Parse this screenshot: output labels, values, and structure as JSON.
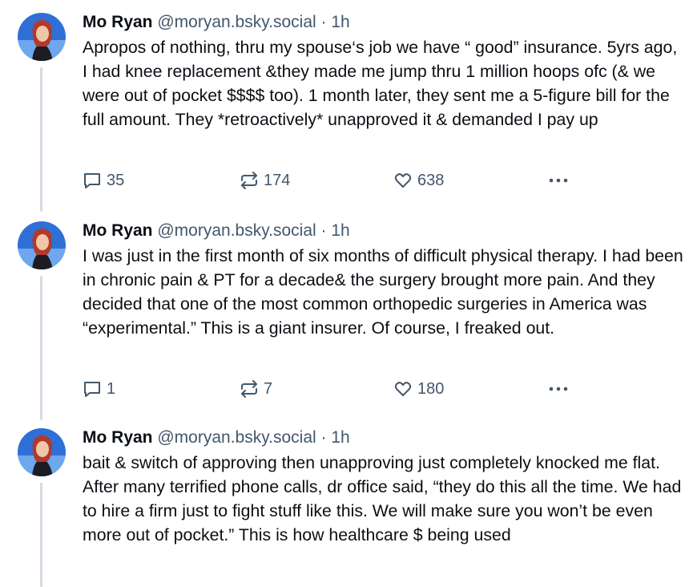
{
  "posts": [
    {
      "author_name": "Mo Ryan",
      "handle": "@moryan.bsky.social",
      "separator": "·",
      "time": "1h",
      "text": "Apropos of nothing, thru my spouse‘s job we have “ good” insurance. 5yrs ago, I had knee replacement &they made me jump thru 1 million hoops ofc (& we were out of pocket $$$$ too). 1 month later, they sent me a 5-figure bill for the full amount. They *retroactively* unapproved it & demanded I pay up",
      "replies": "35",
      "reposts": "174",
      "likes": "638"
    },
    {
      "author_name": "Mo Ryan",
      "handle": "@moryan.bsky.social",
      "separator": "·",
      "time": "1h",
      "text": "I was just in the first month of six months of difficult physical therapy. I had been in chronic pain & PT for a decade& the surgery brought more pain. And they decided that one of the most common orthopedic surgeries in America was “experimental.” This is a giant insurer. Of course, I freaked out.",
      "replies": "1",
      "reposts": "7",
      "likes": "180"
    },
    {
      "author_name": "Mo Ryan",
      "handle": "@moryan.bsky.social",
      "separator": "·",
      "time": "1h",
      "text": "bait & switch of approving then unapproving just completely knocked me flat. After many terrified phone calls, dr office said, “they do this all the time. We had to hire a firm just to fight stuff like this. We will make sure you won’t be even more out of pocket.” This is how healthcare $ being used"
    }
  ],
  "icons": {
    "reply": "speech-bubble-icon",
    "repost": "repost-arrows-icon",
    "like": "heart-outline-icon",
    "more": "ellipsis-icon"
  },
  "colors": {
    "text": "#0b0f14",
    "muted": "#42576c",
    "thread_line": "#d4dbe2"
  }
}
